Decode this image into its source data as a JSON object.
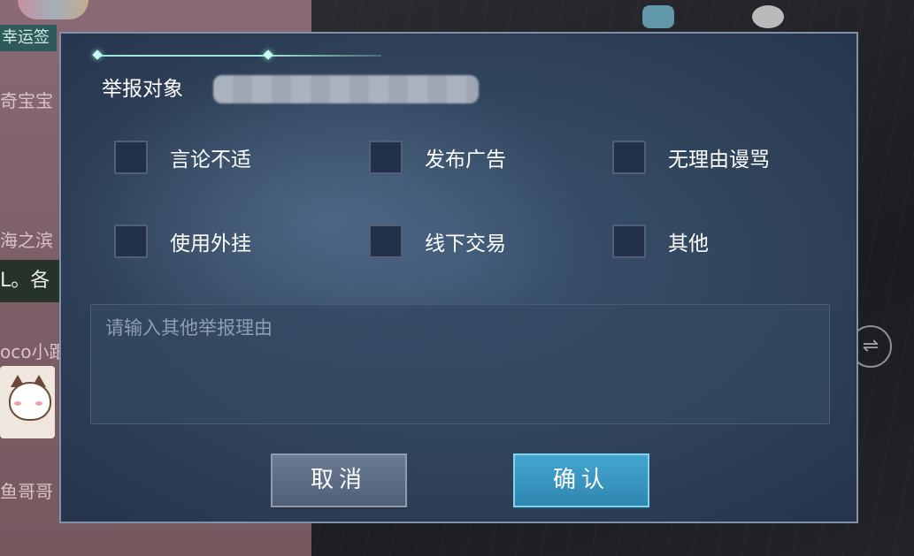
{
  "background": {
    "chip_text": "幸运签",
    "chat_names": [
      "奇宝宝",
      "海之滨",
      "oco小跟",
      "鱼哥哥"
    ],
    "message_fragment": "L。各",
    "side_button_icon": "transfer-icon"
  },
  "dialog": {
    "target_label": "举报对象",
    "target_name": "",
    "options": [
      {
        "label": "言论不适",
        "checked": false
      },
      {
        "label": "发布广告",
        "checked": false
      },
      {
        "label": "无理由谩骂",
        "checked": false
      },
      {
        "label": "使用外挂",
        "checked": false
      },
      {
        "label": "线下交易",
        "checked": false
      },
      {
        "label": "其他",
        "checked": false
      }
    ],
    "reason_placeholder": "请输入其他举报理由",
    "reason_value": "",
    "cancel_label": "取消",
    "confirm_label": "确认"
  },
  "colors": {
    "dialog_bg": "#2f425a",
    "dialog_border": "#7d93ab",
    "accent_line": "#9ee6d6",
    "confirm_button": "#3a98c2",
    "cancel_button": "#5d6d85"
  }
}
